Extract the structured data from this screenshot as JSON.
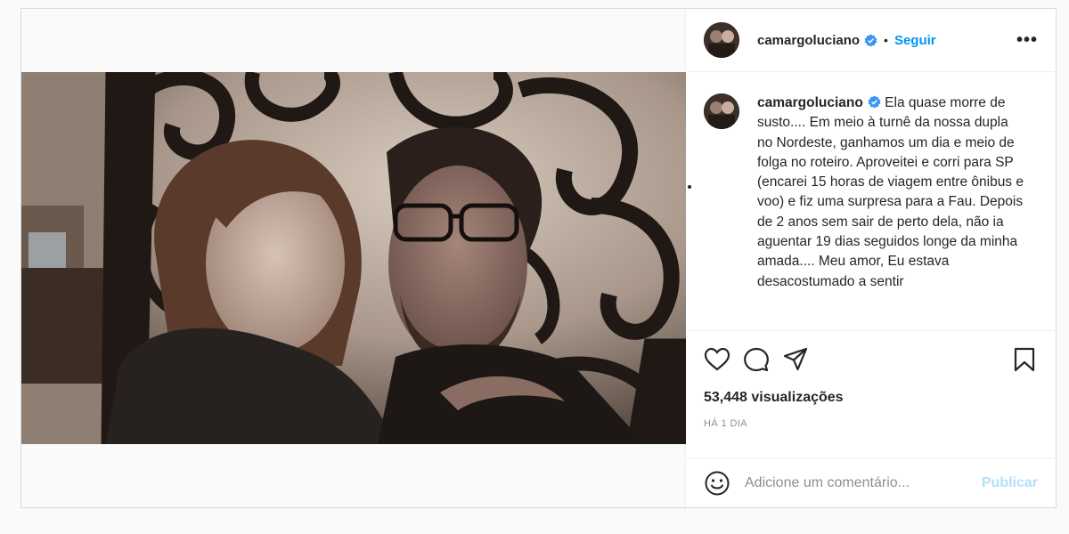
{
  "header": {
    "username": "camargoluciano",
    "separator": "•",
    "follow_label": "Seguir",
    "more_label": "•••"
  },
  "caption": {
    "username": "camargoluciano",
    "text": " Ela quase morre de susto.... Em meio à turnê da nossa dupla no Nordeste, ganhamos um dia e meio de folga no roteiro. Aproveitei e corri para SP (encarei 15 horas de viagem entre ônibus e voo) e fiz uma surpresa para a Fau. Depois de 2 anos sem sair de perto dela, não ia aguentar 19 dias seguidos longe da minha amada.... Meu amor, Eu estava desacostumado a sentir"
  },
  "actions": {
    "icons": [
      "heart-icon",
      "comment-icon",
      "share-icon",
      "bookmark-icon"
    ]
  },
  "stats": {
    "views": "53,448 visualizações",
    "time": "HÁ 1 DIA"
  },
  "comment_box": {
    "placeholder": "Adicione um comentário...",
    "publish_label": "Publicar"
  },
  "colors": {
    "accent": "#0095f6",
    "publish_disabled": "#b2dffc",
    "verified": "#3897f0",
    "text": "#262626",
    "muted": "#8e8e8e"
  }
}
